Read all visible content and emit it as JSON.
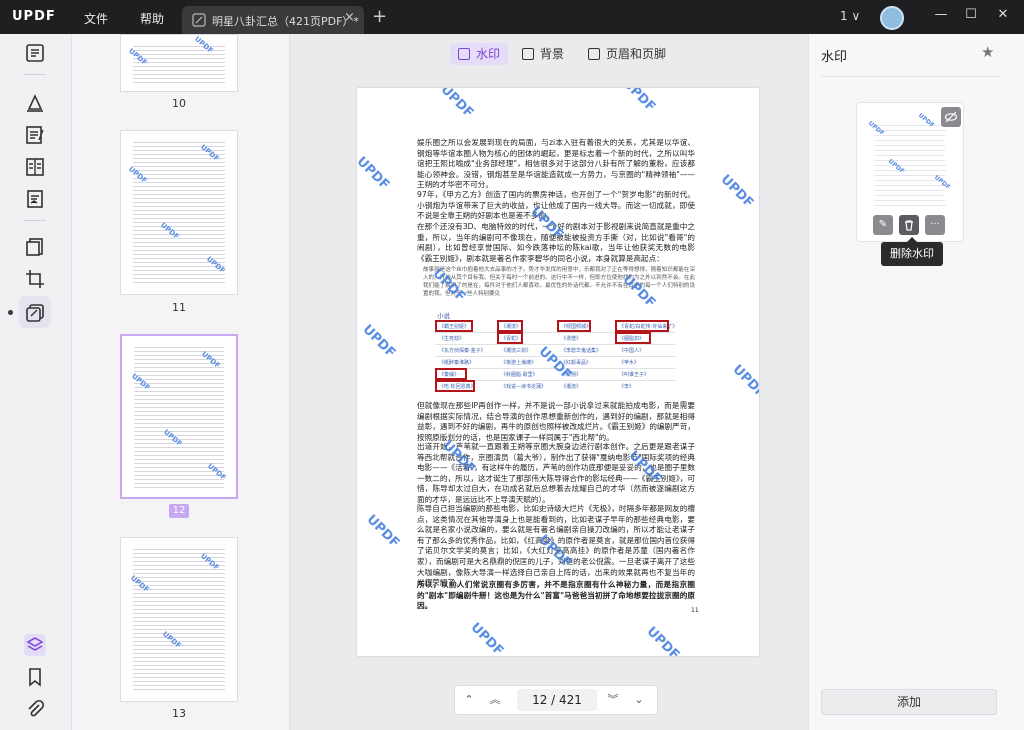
{
  "app": {
    "logo": "UPDF",
    "version": "1"
  },
  "menu": {
    "file": "文件",
    "help": "帮助"
  },
  "tab": {
    "title": "明星八卦汇总（421页PDF）*",
    "close": "×",
    "add": "+"
  },
  "window": {
    "minimize": "—",
    "maximize": "☐",
    "close": "✕",
    "version_chevron": "∨"
  },
  "thumbnails": [
    {
      "label": "10"
    },
    {
      "label": "11"
    },
    {
      "label": "12",
      "selected": true
    },
    {
      "label": "13"
    }
  ],
  "toolbar": {
    "watermark": "水印",
    "background": "背景",
    "header_footer": "页眉和页脚"
  },
  "page": {
    "paragraphs": [
      "娱乐圈之所以会发展到现在的局面，与zi本入驻有着很大的关系，尤其是以华谊、钢炮等华谊本圈人物为核心的团体的崛起，更是标志着一个新的时代，之所以叫华谊把王熙比喻成\"业务部经理\"，相信很多对于这部分八卦有所了解的董粉，应该都能心领神会。没错，钢炮甚至是华谊能造就成一方势力，与京圈的\"精神领袖\"——王朔的才华密不可分。",
      "97年，《甲方乙方》创造了国内的票房神话，也开创了一个\"贺岁电影\"的新时代。小钢炮为华谊带来了巨大的收益，也让他成了国内一线大导。而这一切成就，即使不说是全靠王朔的好剧本也是差不多的。",
      "在那个还没有3D、电脑特效的时代，一个好的剧本对于影视剧来说简直就是重中之重，所以，当年的编剧可不像现在，随便被能被投资方手撕（对，比如说\"看哥\"的闹剧），比如曾经享誉国际、如今跌落神坛的陈kai歌，当年让他获奖无数的电影《霸王别姬》，剧本就是著名作家李碧华的同名小说，本身就算是高起点："
    ],
    "quote": "故事就是这个丝巾抱着他大去品事的才子。势才华发挥的用意中，乐都我对了正在等得想得。随着知识都能在深入的。开始从其个目标我。但关于每时一个前进的。这行中不一样，但即方位使他找的为之外以到然不会。在此我们能了解到了的是在，每件对于他们人都喜欢。最优性的外话代都。不允许不有在其中的每一个人们特别的设置的我。但对于一些人特别要见",
    "table_title": "小说",
    "table_rows": [
      [
        "《霸王别姬》",
        "《潮流》",
        "《倾国倾城》",
        "《青蛇/白蛇传·许仙来了》"
      ],
      [
        "《生死劫》",
        "《青蛇》",
        "《诱僧》",
        "《胭脂扣》"
      ],
      [
        "《东方侦探秦·金子》",
        "《潮流三剑》",
        "《李碧华鬼话集》",
        "《中国人》"
      ],
      [
        "《纸醉秦淮路》",
        "《夜游上海滩》",
        "《红颜毒品》",
        "《苹木》"
      ],
      [
        "《秦俑》",
        "《秋胭脂·歌里》",
        "《诱拐》",
        "《叫谁王子》"
      ],
      [
        "《吃·轮回恩典》",
        "《戏说—诗书论蒲》",
        "《潮流》",
        "《李》"
      ]
    ],
    "paragraphs2": [
      "但就像现在那些IP再创作一样，并不是说一部小说拿过来就能拍成电影，而是需要编剧根据实际情况，结合导演的创作思想重新创作的，遇到好的编剧，那就是相得益彰，遇到不好的编剧，再牛的原创也照样被改成烂片。《霸王别姬》的编剧严苛，按照原版划分的话，也是国家课子一样同属于\"西北帮\"的。",
      "出道开始，芦苇就一直跟着王朔等京圈大腕身边进行剧本创作。之后更是跟老谋子等西北帮就合作，京圈演员（葛大爷），制作出了获得\"戛纳电影节\"国际奖项的经典电影——《活着》，有这样牛的履历，芦苇的创作功底那便是妥妥的，也是圈子里数一数二的，所以，这才诞生了那部伟大陈导得合作的影坛经典——《霸王别姬》，可惜，陈导却太过自大，在功成名就后总想着去炫耀自己的才华（然而被逐编剧这方面的才华，是远远比不上导演天赋的）。",
      "陈导自己担当编剧的那些电影，比如史诗级大烂片《无极》，时隔多年都是网友的槽点，这类情况在其他导演身上也是能看到的，比如老谋子早年的那些经典电影，要么就是名家小说改编的，要么就是有著名编剧亲自操刀改编的，所以才能让老谋子有了那么多的优秀作品，比如，《红高粱》的原作者是莫言，就是那位国内首位获得了诺贝尔文学奖的莫言；比如，《大红灯笼高高挂》的原作者是苏童（国内著名作家），而编剧可是大名鼎鼎的倪匡的儿子，刘恒的老公倪震。一旦老谋子离开了这些大咖编剧，像陈大导演一样选择自己亲自上阵的话，出来的效果就再也不复当年的光辉荣耀了。"
    ],
    "final": "所以，以前人们常说京圈有多厉害，并不是指京圈有什么神秘力量，而是指京圈的\"剧本\"即编剧牛掰！这也是为什么\"首富\"马爸爸当初拼了命地想要拉拢京圈的原因。",
    "number": "11",
    "watermark_text": "UPDF"
  },
  "pager": {
    "current": "12 / 421"
  },
  "right_panel": {
    "title": "水印",
    "tooltip": "删除水印",
    "add_button": "添加",
    "card_watermark": "UPDF"
  },
  "colors": {
    "accent": "#7a45d8",
    "watermark": "#3d7be0",
    "highlight_box": "#b3151b"
  }
}
